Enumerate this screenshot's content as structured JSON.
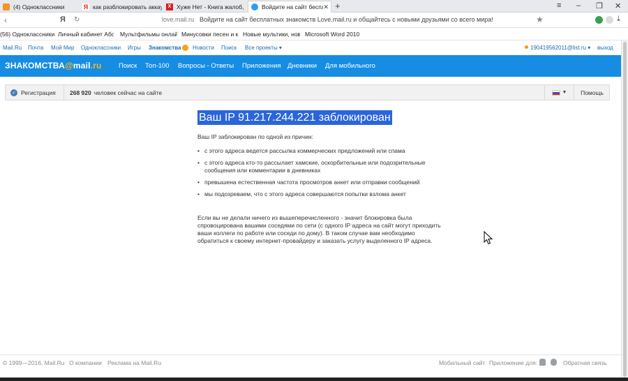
{
  "browser": {
    "tabs": [
      {
        "title": "(4) Одноклассники",
        "favicon": "ok-icon",
        "active": false
      },
      {
        "title": "как разблокировать аккаунт",
        "favicon": "yandex-icon",
        "active": false
      },
      {
        "title": "Хуже Нет - Книга жалоб, Отзы",
        "favicon": "x-red-icon",
        "active": false
      },
      {
        "title": "Войдите на сайт бесплатных з",
        "favicon": "mailru-icon",
        "active": true
      }
    ],
    "new_tab": "+",
    "address": {
      "host": "love.mail.ru",
      "page_title": "Войдите на сайт бесплатных знакомств Love.mail.ru и общайтесь с новыми друзьями со всего мира!"
    },
    "bookmarks": [
      "(56) Одноклассники",
      "Личный кабинет Або",
      "Мультфильмы онлайн",
      "Минусовки песен и к",
      "Новые мультики, нов",
      "Microsoft Word 2010"
    ]
  },
  "mailru_nav": {
    "links": [
      "Mail.Ru",
      "Почта",
      "Мой Мир",
      "Одноклассники",
      "Игры",
      "Знакомства",
      "Новости",
      "Поиск",
      "Все проекты ▾"
    ],
    "user": "190419562011@list.ru ▾",
    "logout": "выход"
  },
  "banner": {
    "logo_main": "ЗНАКОМСТВА",
    "logo_at": "@",
    "logo_mail": "mail",
    "logo_dot": ".ru",
    "items": [
      "Поиск",
      "Топ-100",
      "Вопросы - Ответы",
      "Приложения",
      "Дневники",
      "Для мобильного"
    ]
  },
  "status": {
    "registration": "Регистрация",
    "online_count": "268 920",
    "online_text": "человек сейчас на сайте",
    "help": "Помощь"
  },
  "main": {
    "title": "Ваш IP 91.217.244.221 заблокирован",
    "intro": "Ваш IP заблокирован по одной из причин:",
    "reasons": [
      "с этого адреса ведется рассылка коммерческих предложений или спама",
      "с этого адреса кто-то рассылает хамские, оскорбительные или подозрительные сообщения или комментарии в дневниках",
      "превышена естественная частота просмотров анкет или отправки сообщений",
      "мы подозреваем, что с этого адреса совершаются попытки взлома анкет"
    ],
    "paragraph": "Если вы не делали ничего из вышеперечисленного - значит блокировка была спровоцирована вашими соседями по сети (с одного IP адреса на сайт могут приходить ваши коллеги по работе или соседи по дому). В таком случае вам необходимо обратиться к своему интернет-провайдеру и заказать услугу выделенного IP адреса."
  },
  "footer": {
    "copyright": "© 1999—2016, Mail.Ru",
    "about": "О компании",
    "ads": "Реклама на Mail.Ru",
    "mobile": "Мобильный сайт",
    "apps": "Приложение для:",
    "feedback": "Обратная связь"
  },
  "colors": {
    "banner": "#168de2",
    "link": "#1d6bb0",
    "highlight": "#2b65d9",
    "badge": "#f7a21e"
  }
}
